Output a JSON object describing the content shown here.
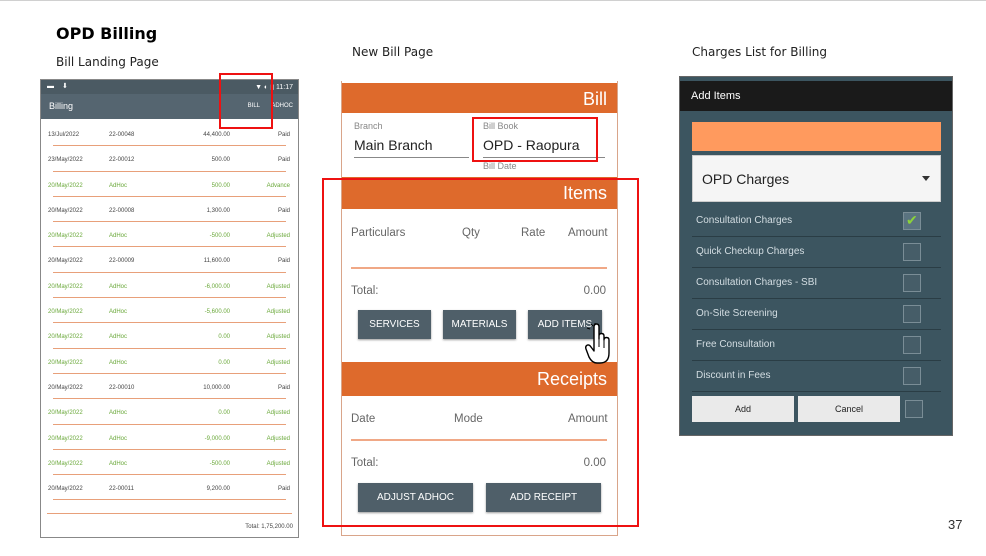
{
  "slide": {
    "title": "OPD Billing",
    "captions": {
      "landing": "Bill Landing Page",
      "new_bill": "New Bill Page",
      "charges": "Charges List for Billing"
    },
    "page_number": "37"
  },
  "landing": {
    "status_left": "▬ ⬇",
    "status_right": "▼ ◐ ▮ 11:17",
    "title": "Billing",
    "btn_bill": "BILL",
    "btn_adhoc": "ADHOC",
    "rows": [
      {
        "date": "13/Jul/2022",
        "no": "22-00048",
        "amount": "44,400.00",
        "status": "Paid",
        "green": false
      },
      {
        "date": "23/May/2022",
        "no": "22-00012",
        "amount": "500.00",
        "status": "Paid",
        "green": false
      },
      {
        "date": "20/May/2022",
        "no": "AdHoc",
        "amount": "500.00",
        "status": "Advance",
        "green": true
      },
      {
        "date": "20/May/2022",
        "no": "22-00008",
        "amount": "1,300.00",
        "status": "Paid",
        "green": false
      },
      {
        "date": "20/May/2022",
        "no": "AdHoc",
        "amount": "-500.00",
        "status": "Adjusted",
        "green": true
      },
      {
        "date": "20/May/2022",
        "no": "22-00009",
        "amount": "11,600.00",
        "status": "Paid",
        "green": false
      },
      {
        "date": "20/May/2022",
        "no": "AdHoc",
        "amount": "-6,000.00",
        "status": "Adjusted",
        "green": true
      },
      {
        "date": "20/May/2022",
        "no": "AdHoc",
        "amount": "-5,600.00",
        "status": "Adjusted",
        "green": true
      },
      {
        "date": "20/May/2022",
        "no": "AdHoc",
        "amount": "0.00",
        "status": "Adjusted",
        "green": true
      },
      {
        "date": "20/May/2022",
        "no": "AdHoc",
        "amount": "0.00",
        "status": "Adjusted",
        "green": true
      },
      {
        "date": "20/May/2022",
        "no": "22-00010",
        "amount": "10,000.00",
        "status": "Paid",
        "green": false
      },
      {
        "date": "20/May/2022",
        "no": "AdHoc",
        "amount": "0.00",
        "status": "Adjusted",
        "green": true
      },
      {
        "date": "20/May/2022",
        "no": "AdHoc",
        "amount": "-9,000.00",
        "status": "Adjusted",
        "green": true
      },
      {
        "date": "20/May/2022",
        "no": "AdHoc",
        "amount": "-500.00",
        "status": "Adjusted",
        "green": true
      },
      {
        "date": "20/May/2022",
        "no": "22-00011",
        "amount": "9,200.00",
        "status": "Paid",
        "green": false
      }
    ],
    "total": "Total: 1,75,200.00"
  },
  "new_bill": {
    "header": "Bill",
    "branch_label": "Branch",
    "branch_value": "Main Branch",
    "billbook_label": "Bill Book",
    "billbook_value": "OPD - Raopura",
    "billdate_label": "Bill Date",
    "items_header": "Items",
    "items_cols": [
      "Particulars",
      "Qty",
      "Rate",
      "Amount"
    ],
    "items_total_label": "Total:",
    "items_total_value": "0.00",
    "btn_services": "SERVICES",
    "btn_materials": "MATERIALS",
    "btn_add_items": "ADD ITEMS",
    "receipts_header": "Receipts",
    "receipts_cols": [
      "Date",
      "Mode",
      "Amount"
    ],
    "receipts_total_label": "Total:",
    "receipts_total_value": "0.00",
    "btn_adjust_adhoc": "ADJUST ADHOC",
    "btn_add_receipt": "ADD RECEIPT"
  },
  "add_items": {
    "title": "Add Items",
    "category": "OPD Charges",
    "items": [
      {
        "label": "Consultation Charges",
        "checked": true
      },
      {
        "label": "Quick Checkup Charges",
        "checked": false
      },
      {
        "label": "Consultation Charges - SBI",
        "checked": false
      },
      {
        "label": "On-Site Screening",
        "checked": false
      },
      {
        "label": "Free Consultation",
        "checked": false
      },
      {
        "label": "Discount in Fees",
        "checked": false
      }
    ],
    "btn_add": "Add",
    "btn_cancel": "Cancel"
  },
  "colors": {
    "accent_orange": "#de6a2c",
    "highlight_red": "#e11111",
    "toolbar_slate": "#556570",
    "dialog_bg": "#3c5560",
    "search_orange": "#ff9a5e",
    "adhoc_green": "#6aa83a"
  }
}
